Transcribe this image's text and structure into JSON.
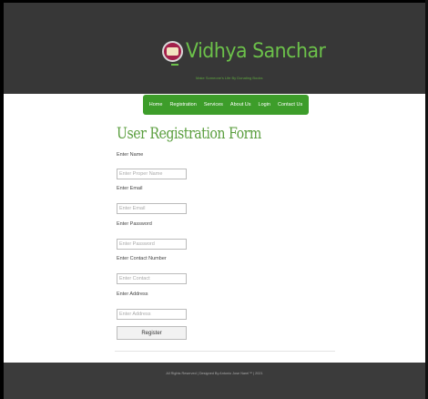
{
  "header": {
    "site_title": "Vidhya Sanchar",
    "tagline": "Make Someone's Life By Donating Books"
  },
  "nav": {
    "items": [
      "Home",
      "Registration",
      "Services",
      "About Us",
      "Login",
      "Contact Us"
    ]
  },
  "form": {
    "title": "User Registration Form",
    "fields": [
      {
        "label": "Enter Name",
        "placeholder": "Enter Proper Name"
      },
      {
        "label": "Enter Email",
        "placeholder": "Enter Email"
      },
      {
        "label": "Enter Password",
        "placeholder": "Enter Password"
      },
      {
        "label": "Enter Contact Number",
        "placeholder": "Enter Contact"
      },
      {
        "label": "Enter Address",
        "placeholder": "Enter Address"
      }
    ],
    "submit_label": "Register"
  },
  "footer": {
    "text": "All Rights Reserved | Designed By Antonio Jose Narel™ | 2021"
  },
  "colors": {
    "header_bg": "#373737",
    "accent_green": "#3d9d2a",
    "title_green": "#6cc14a",
    "footer_bg": "#3b3b3b"
  }
}
